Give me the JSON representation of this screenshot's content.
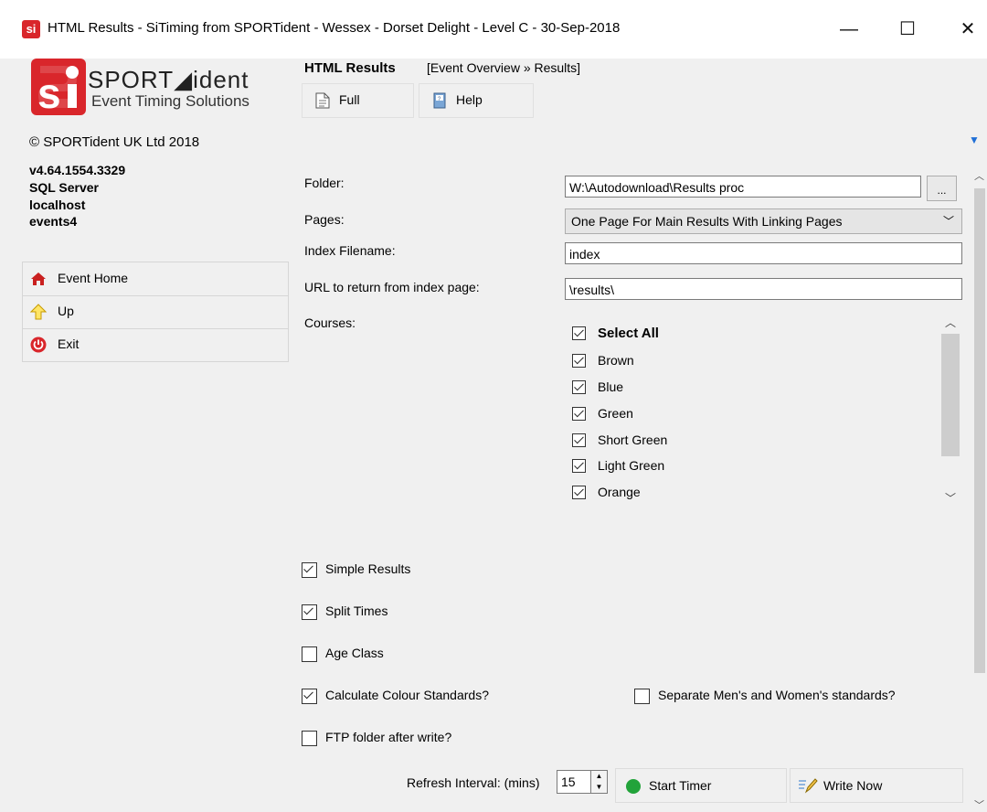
{
  "window": {
    "title": "HTML Results - SiTiming from SPORTident - Wessex - Dorset Delight - Level C - 30-Sep-2018",
    "app_icon_text": "si",
    "minimize": "—",
    "maximize": "☐",
    "close": "✕"
  },
  "brand": {
    "logo_name": "SPORT◢ident",
    "logo_tagline": "Event Timing Solutions",
    "copyright": "© SPORTident UK Ltd 2018",
    "version": "v4.64.1554.3329",
    "db_type": "SQL Server",
    "host": "localhost",
    "database": "events4",
    "accent_color": "#d9262b"
  },
  "nav": {
    "items": [
      {
        "label": "Event Home",
        "icon": "home-icon"
      },
      {
        "label": "Up",
        "icon": "up-arrow-icon"
      },
      {
        "label": "Exit",
        "icon": "power-icon"
      }
    ]
  },
  "header": {
    "title": "HTML Results",
    "breadcrumb": "[Event Overview » Results]"
  },
  "toolbar": {
    "full_label": "Full",
    "help_label": "Help"
  },
  "form": {
    "folder_label": "Folder:",
    "folder_value": "W:\\Autodownload\\Results proc",
    "browse_label": "...",
    "pages_label": "Pages:",
    "pages_value": "One Page For Main Results With Linking Pages",
    "index_label": "Index Filename:",
    "index_value": "index",
    "url_label": "URL to return from index page:",
    "url_value": "\\results\\",
    "courses_label": "Courses:"
  },
  "courses": {
    "select_all": "Select All",
    "items": [
      "Brown",
      "Blue",
      "Green",
      "Short Green",
      "Light Green",
      "Orange"
    ]
  },
  "options": {
    "simple_results": {
      "label": "Simple Results",
      "checked": true
    },
    "split_times": {
      "label": "Split Times",
      "checked": true
    },
    "age_class": {
      "label": "Age Class",
      "checked": false
    },
    "colour_standards": {
      "label": "Calculate Colour Standards?",
      "checked": true
    },
    "separate_standards": {
      "label": "Separate Men's and Women's standards?",
      "checked": false
    },
    "ftp_folder": {
      "label": "FTP folder after write?",
      "checked": false
    }
  },
  "bottom": {
    "refresh_label": "Refresh Interval: (mins)",
    "refresh_value": "15",
    "start_timer_label": "Start Timer",
    "write_now_label": "Write Now"
  }
}
